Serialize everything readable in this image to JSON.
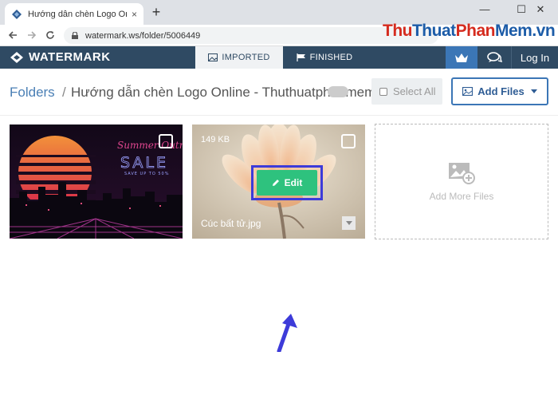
{
  "browser": {
    "tab_title": "Hướng dẫn chèn Logo Online - T",
    "tab_close": "×",
    "new_tab": "+",
    "url": "watermark.ws/folder/5006449",
    "window_controls": [
      "—",
      "☐",
      "✕"
    ],
    "watermark_brand": [
      "Thu",
      "Thuat",
      "Phan",
      "Mem",
      ".vn"
    ]
  },
  "app_nav": {
    "logo": "WATERMARK",
    "tabs": [
      {
        "label": "IMPORTED",
        "active": true
      },
      {
        "label": "FINISHED",
        "active": false
      }
    ],
    "login": "Log In",
    "accent_color": "#3b76b6",
    "bar_color": "#2f4a63"
  },
  "header": {
    "breadcrumb_root": "Folders",
    "breadcrumb_sep": "/",
    "folder_title": "Hướng dẫn chèn Logo Online - Thuthuatphanmem",
    "select_all": "Select All",
    "add_files": "Add Files"
  },
  "files": [
    {
      "name": "Summer Outrun SALE",
      "poster_text": [
        "Summer Outrun",
        "SALE",
        "SAVE UP TO 50%"
      ]
    },
    {
      "name": "Cúc bất tử.jpg",
      "size": "149 KB",
      "edit_label": "Edit"
    }
  ],
  "add_more": "Add More Files",
  "colors": {
    "edit_green": "#2ec27e",
    "highlight_blue": "#3d3bd9",
    "link_blue": "#4a7fb5"
  }
}
